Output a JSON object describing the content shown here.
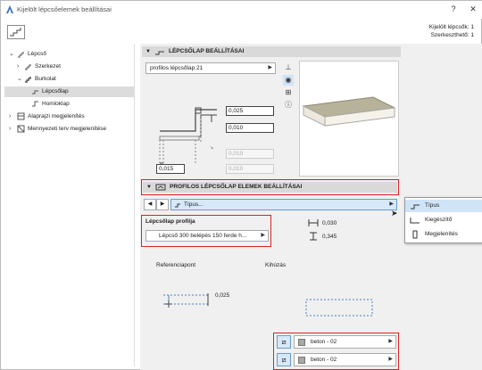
{
  "window": {
    "title": "Kijelölt lépcsőelemek beállításai",
    "help": "?",
    "close": "✕"
  },
  "info": {
    "selected_label": "Kijelölt lépcsők: 1",
    "editable_label": "Szerkeszthető: 1"
  },
  "tree": {
    "items": [
      {
        "label": "Lépcső",
        "level": 0,
        "expanded": true
      },
      {
        "label": "Szerkezet",
        "level": 1,
        "expanded": false
      },
      {
        "label": "Burkolat",
        "level": 1,
        "expanded": true
      },
      {
        "label": "Lépcsőlap",
        "level": 2,
        "selected": true
      },
      {
        "label": "Homloklap",
        "level": 2
      },
      {
        "label": "Alaprajzi megjelenítés",
        "level": 0,
        "expanded": false
      },
      {
        "label": "Mennyezeti terv megjelenítése",
        "level": 0,
        "expanded": false
      }
    ]
  },
  "section1": {
    "title": "LÉPCSŐLAP BEÁLLÍTÁSAI",
    "profile_dropdown": "profilos lépcsőlap 21"
  },
  "dims": {
    "field1": "0,025",
    "field2": "0,010",
    "field3": "0,015",
    "field4": "0,010",
    "field5": "0,010"
  },
  "section2": {
    "title": "PROFILOS LÉPCSŐLAP ELEMEK BEÁLLÍTÁSAI",
    "type_dropdown": "Típus..."
  },
  "profile": {
    "label": "Lépcsőlap profilja",
    "dropdown": "Lépcső 300 belépés 150 ferde h..."
  },
  "measures": {
    "m1": "0,030",
    "m2": "0,345"
  },
  "reference": {
    "label": "Referenciapont",
    "value": "0,025"
  },
  "extension": {
    "label": "Kihúzás"
  },
  "materials": [
    {
      "label": "beton - 02"
    },
    {
      "label": "beton - 02"
    }
  ],
  "popup": {
    "items": [
      {
        "label": "Típus",
        "selected": true
      },
      {
        "label": "Kiegészítő",
        "selected": false
      },
      {
        "label": "Megjelenítés",
        "selected": false
      }
    ]
  },
  "colors": {
    "highlight_red": "#d22222",
    "popup_selected": "#cfe4f7",
    "header_gray": "#d9d9d9"
  }
}
